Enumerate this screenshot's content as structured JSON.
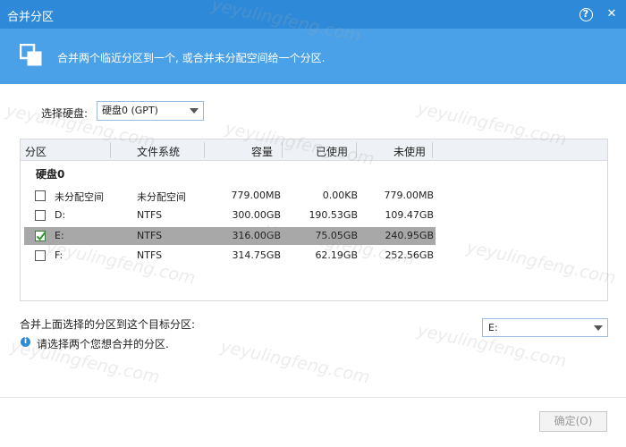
{
  "window": {
    "title": "合并分区",
    "help_icon": "help-icon",
    "close_icon": "close-icon"
  },
  "banner": {
    "icon": "merge-partitions-icon",
    "description": "合并两个临近分区到一个, 或合并未分配空间给一个分区."
  },
  "disk_selector": {
    "label": "选择硬盘:",
    "value": "硬盘0 (GPT)"
  },
  "table": {
    "headers": {
      "partition": "分区",
      "filesystem": "文件系统",
      "capacity": "容量",
      "used": "已使用",
      "free": "未使用"
    },
    "group": "硬盘0",
    "rows": [
      {
        "name": "未分配空间",
        "filesystem": "未分配空间",
        "capacity": "779.00MB",
        "used": "0.00KB",
        "free": "779.00MB",
        "checked": false,
        "selected": false
      },
      {
        "name": "D:",
        "filesystem": "NTFS",
        "capacity": "300.00GB",
        "used": "190.53GB",
        "free": "109.47GB",
        "checked": false,
        "selected": false
      },
      {
        "name": "E:",
        "filesystem": "NTFS",
        "capacity": "316.00GB",
        "used": "75.05GB",
        "free": "240.95GB",
        "checked": true,
        "selected": true
      },
      {
        "name": "F:",
        "filesystem": "NTFS",
        "capacity": "314.75GB",
        "used": "62.19GB",
        "free": "252.56GB",
        "checked": false,
        "selected": false
      }
    ]
  },
  "merge_target": {
    "label": "合并上面选择的分区到这个目标分区:",
    "value": "E:"
  },
  "hint": {
    "icon": "info-icon",
    "text": "请选择两个您想合并的分区."
  },
  "buttons": {
    "ok": "确定(O)"
  },
  "watermark": "yeyulingfeng.com",
  "colors": {
    "titlebar": "#2e8ad8",
    "banner": "#4aa1e8",
    "selected_row": "#a8a8a8"
  }
}
